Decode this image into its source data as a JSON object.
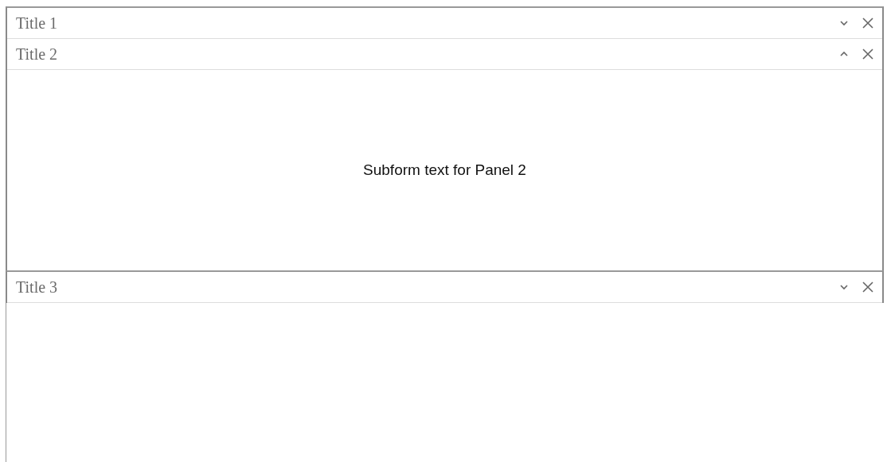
{
  "panels": [
    {
      "title": "Title 1",
      "expanded": false
    },
    {
      "title": "Title 2",
      "expanded": true,
      "body": "Subform text for Panel 2"
    },
    {
      "title": "Title 3",
      "expanded": false
    }
  ]
}
